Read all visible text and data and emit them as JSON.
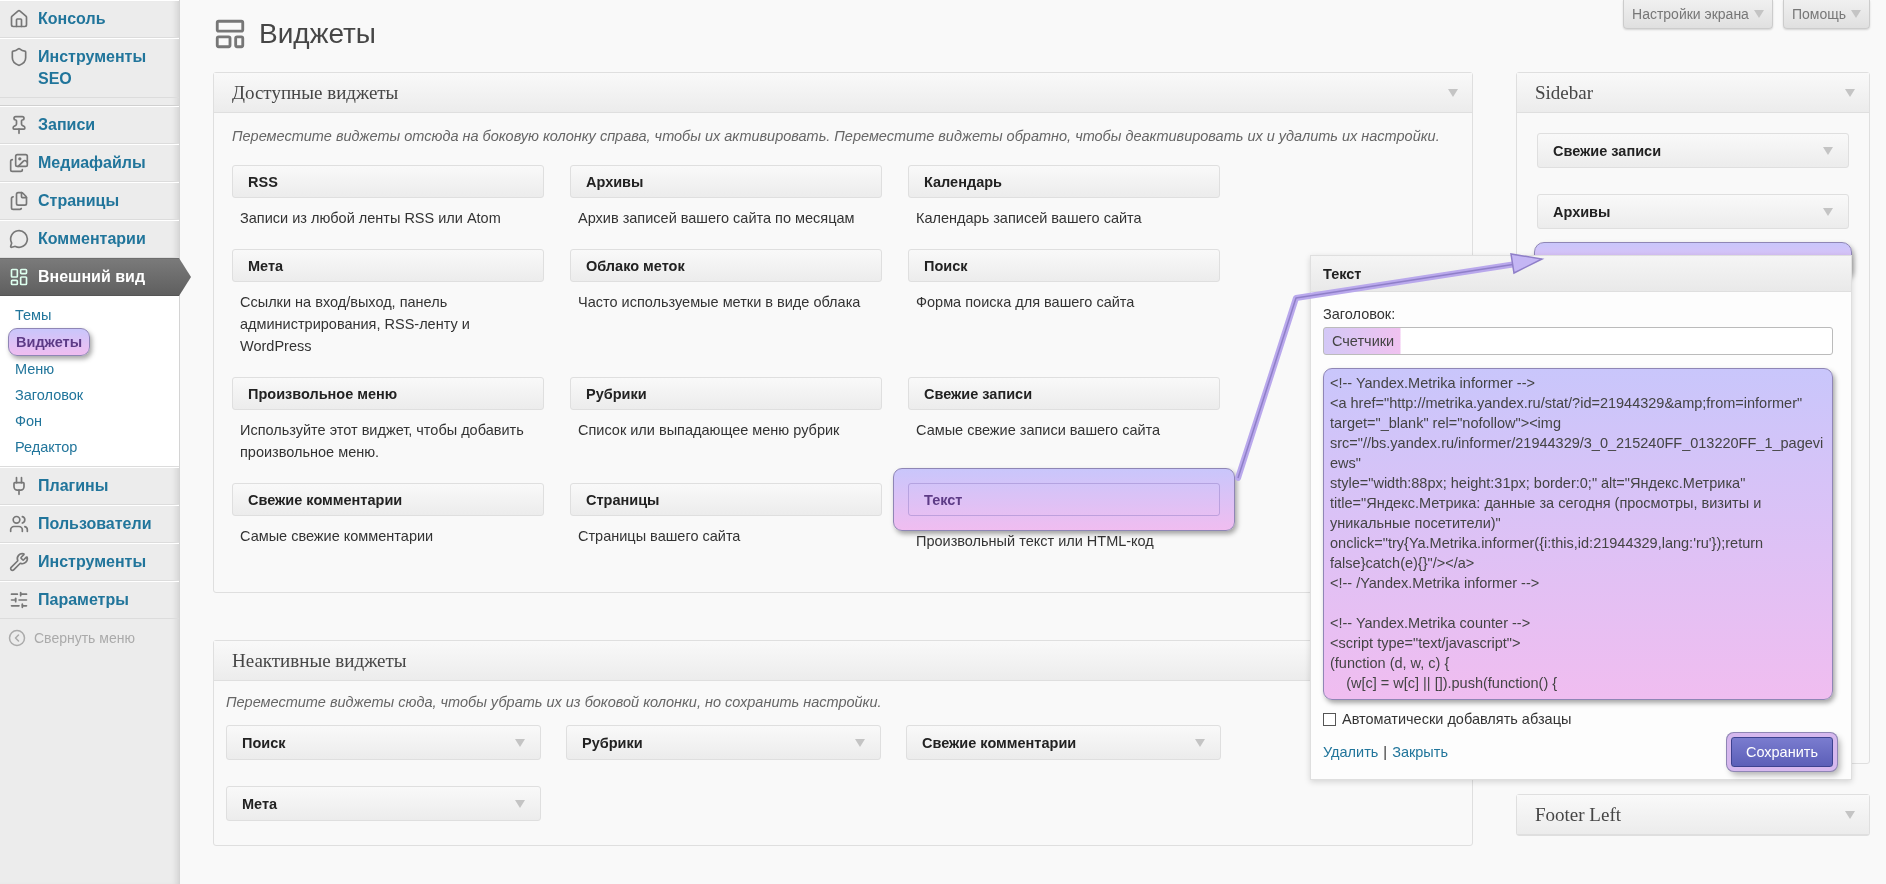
{
  "admin_menu": {
    "items": [
      {
        "label": "Консоль",
        "selected": false
      },
      {
        "label": "Инструменты SEO",
        "selected": false
      },
      {
        "label": "Записи",
        "selected": false
      },
      {
        "label": "Медиафайлы",
        "selected": false
      },
      {
        "label": "Страницы",
        "selected": false
      },
      {
        "label": "Комментарии",
        "selected": false
      },
      {
        "label": "Внешний вид",
        "selected": true,
        "children": [
          {
            "label": "Темы",
            "selected": false,
            "highlighted": false
          },
          {
            "label": "Виджеты",
            "selected": true,
            "highlighted": true
          },
          {
            "label": "Меню",
            "selected": false,
            "highlighted": false
          },
          {
            "label": "Заголовок",
            "selected": false,
            "highlighted": false
          },
          {
            "label": "Фон",
            "selected": false,
            "highlighted": false
          },
          {
            "label": "Редактор",
            "selected": false,
            "highlighted": false
          }
        ]
      },
      {
        "label": "Плагины",
        "selected": false
      },
      {
        "label": "Пользователи",
        "selected": false
      },
      {
        "label": "Инструменты",
        "selected": false
      },
      {
        "label": "Параметры",
        "selected": false
      }
    ],
    "collapse": "Свернуть меню"
  },
  "screen_buttons": [
    "Настройки экрана",
    "Помощь"
  ],
  "page_title": "Виджеты",
  "available_widgets": {
    "title": "Доступные виджеты",
    "description": "Переместите виджеты отсюда на боковую колонку справа, чтобы их активировать. Переместите виджеты обратно, чтобы деактивировать их и удалить их настройки.",
    "widgets": [
      {
        "name": "RSS",
        "description": "Записи из любой ленты RSS или Atom",
        "highlighted": false
      },
      {
        "name": "Архивы",
        "description": "Архив записей вашего сайта по месяцам",
        "highlighted": false
      },
      {
        "name": "Календарь",
        "description": "Календарь записей вашего сайта",
        "highlighted": false
      },
      {
        "name": "Мета",
        "description": "Ссылки на вход/выход, панель администрирования, RSS-ленту и WordPress",
        "highlighted": false
      },
      {
        "name": "Облако меток",
        "description": "Часто используемые метки в виде облака",
        "highlighted": false
      },
      {
        "name": "Поиск",
        "description": "Форма поиска для вашего сайта",
        "highlighted": false
      },
      {
        "name": "Произвольное меню",
        "description": "Используйте этот виджет, чтобы добавить произвольное меню.",
        "highlighted": false
      },
      {
        "name": "Рубрики",
        "description": "Список или выпадающее меню рубрик",
        "highlighted": false
      },
      {
        "name": "Свежие записи",
        "description": "Самые свежие записи вашего сайта",
        "highlighted": false
      },
      {
        "name": "Свежие комментарии",
        "description": "Самые свежие комментарии",
        "highlighted": false
      },
      {
        "name": "Страницы",
        "description": "Страницы вашего сайта",
        "highlighted": false
      },
      {
        "name": "Текст",
        "description": "Произвольный текст или HTML-код",
        "highlighted": true
      }
    ]
  },
  "inactive_widgets": {
    "title": "Неактивные виджеты",
    "description": "Переместите виджеты сюда, чтобы убрать их из боковой колонки, но сохранить настройки.",
    "widgets": [
      "Поиск",
      "Рубрики",
      "Свежие комментарии",
      "Мета"
    ]
  },
  "sidebars": [
    {
      "title": "Sidebar",
      "widgets": [
        "Свежие записи",
        "Архивы"
      ],
      "drop_placeholder": true
    },
    {
      "title": "Footer Left",
      "drop_placeholder": false
    }
  ],
  "widget_editor": {
    "title": "Текст",
    "title_label": "Заголовок:",
    "title_value": "Счетчики",
    "title_highlighted": true,
    "content": "<!-- Yandex.Metrika informer -->\n<a href=\"http://metrika.yandex.ru/stat/?id=21944329&amp;from=informer\"\ntarget=\"_blank\" rel=\"nofollow\"><img\nsrc=\"//bs.yandex.ru/informer/21944329/3_0_215240FF_013220FF_1_pageviews\"\nstyle=\"width:88px; height:31px; border:0;\" alt=\"Яндекс.Метрика\"\ntitle=\"Яндекс.Метрика: данные за сегодня (просмотры, визиты и уникальные посетители)\"\nonclick=\"try{Ya.Metrika.informer({i:this,id:21944329,lang:'ru'});return false}catch(e){}\"/></a>\n<!-- /Yandex.Metrika informer -->\n\n<!-- Yandex.Metrika counter -->\n<script type=\"text/javascript\">\n(function (d, w, c) {\n    (w[c] = w[c] || []).push(function() {",
    "content_highlighted": true,
    "auto_paragraphs": {
      "label": "Автоматически добавлять абзацы",
      "checked": false
    },
    "delete_link": "Удалить",
    "separator": "|",
    "close_link": "Закрыть",
    "save_button": "Сохранить",
    "save_highlighted": true
  }
}
